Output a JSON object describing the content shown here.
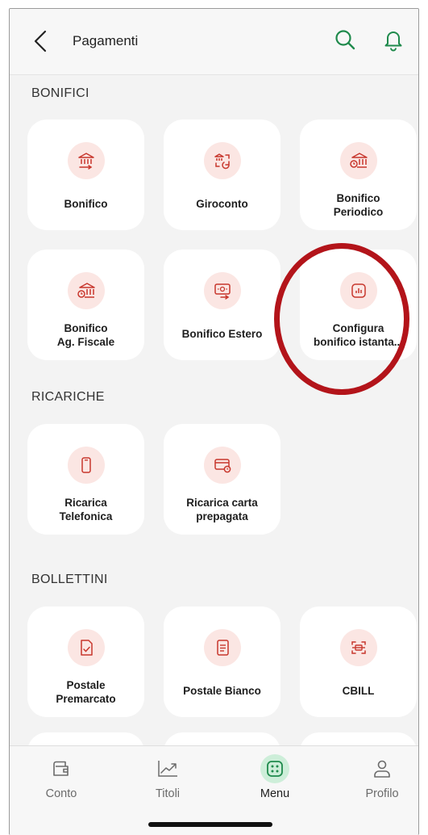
{
  "header": {
    "title": "Pagamenti"
  },
  "sections": {
    "bonifici": {
      "label": "BONIFICI",
      "tiles": [
        {
          "label": "Bonifico",
          "icon": "bank-transfer-icon"
        },
        {
          "label": "Giroconto",
          "icon": "bank-swap-icon"
        },
        {
          "label": "Bonifico\nPeriodico",
          "icon": "bank-clock-icon"
        },
        {
          "label": "Bonifico\nAg. Fiscale",
          "icon": "bank-clock-icon"
        },
        {
          "label": "Bonifico Estero",
          "icon": "foreign-transfer-icon"
        },
        {
          "label": "Configura\nbonifico istanta...",
          "icon": "instant-chart-icon"
        }
      ]
    },
    "ricariche": {
      "label": "RICARICHE",
      "tiles": [
        {
          "label": "Ricarica\nTelefonica",
          "icon": "phone-icon"
        },
        {
          "label": "Ricarica carta\nprepagata",
          "icon": "prepaid-card-icon"
        }
      ]
    },
    "bollettini": {
      "label": "BOLLETTINI",
      "tiles": [
        {
          "label": "Postale\nPremarcato",
          "icon": "premarked-slip-icon"
        },
        {
          "label": "Postale Bianco",
          "icon": "blank-slip-icon"
        },
        {
          "label": "CBILL",
          "icon": "scan-icon"
        }
      ]
    }
  },
  "bottom_nav": {
    "items": [
      {
        "label": "Conto",
        "icon": "wallet-icon",
        "active": false
      },
      {
        "label": "Titoli",
        "icon": "chart-trend-icon",
        "active": false
      },
      {
        "label": "Menu",
        "icon": "menu-grid-icon",
        "active": true
      },
      {
        "label": "Profilo",
        "icon": "user-icon",
        "active": false
      }
    ]
  },
  "colors": {
    "accent_green": "#1f8a4c",
    "icon_red": "#c8372d",
    "icon_bg": "#fbe6e3",
    "highlight_ring": "#b3141a",
    "page_bg": "#f3f3f3"
  }
}
